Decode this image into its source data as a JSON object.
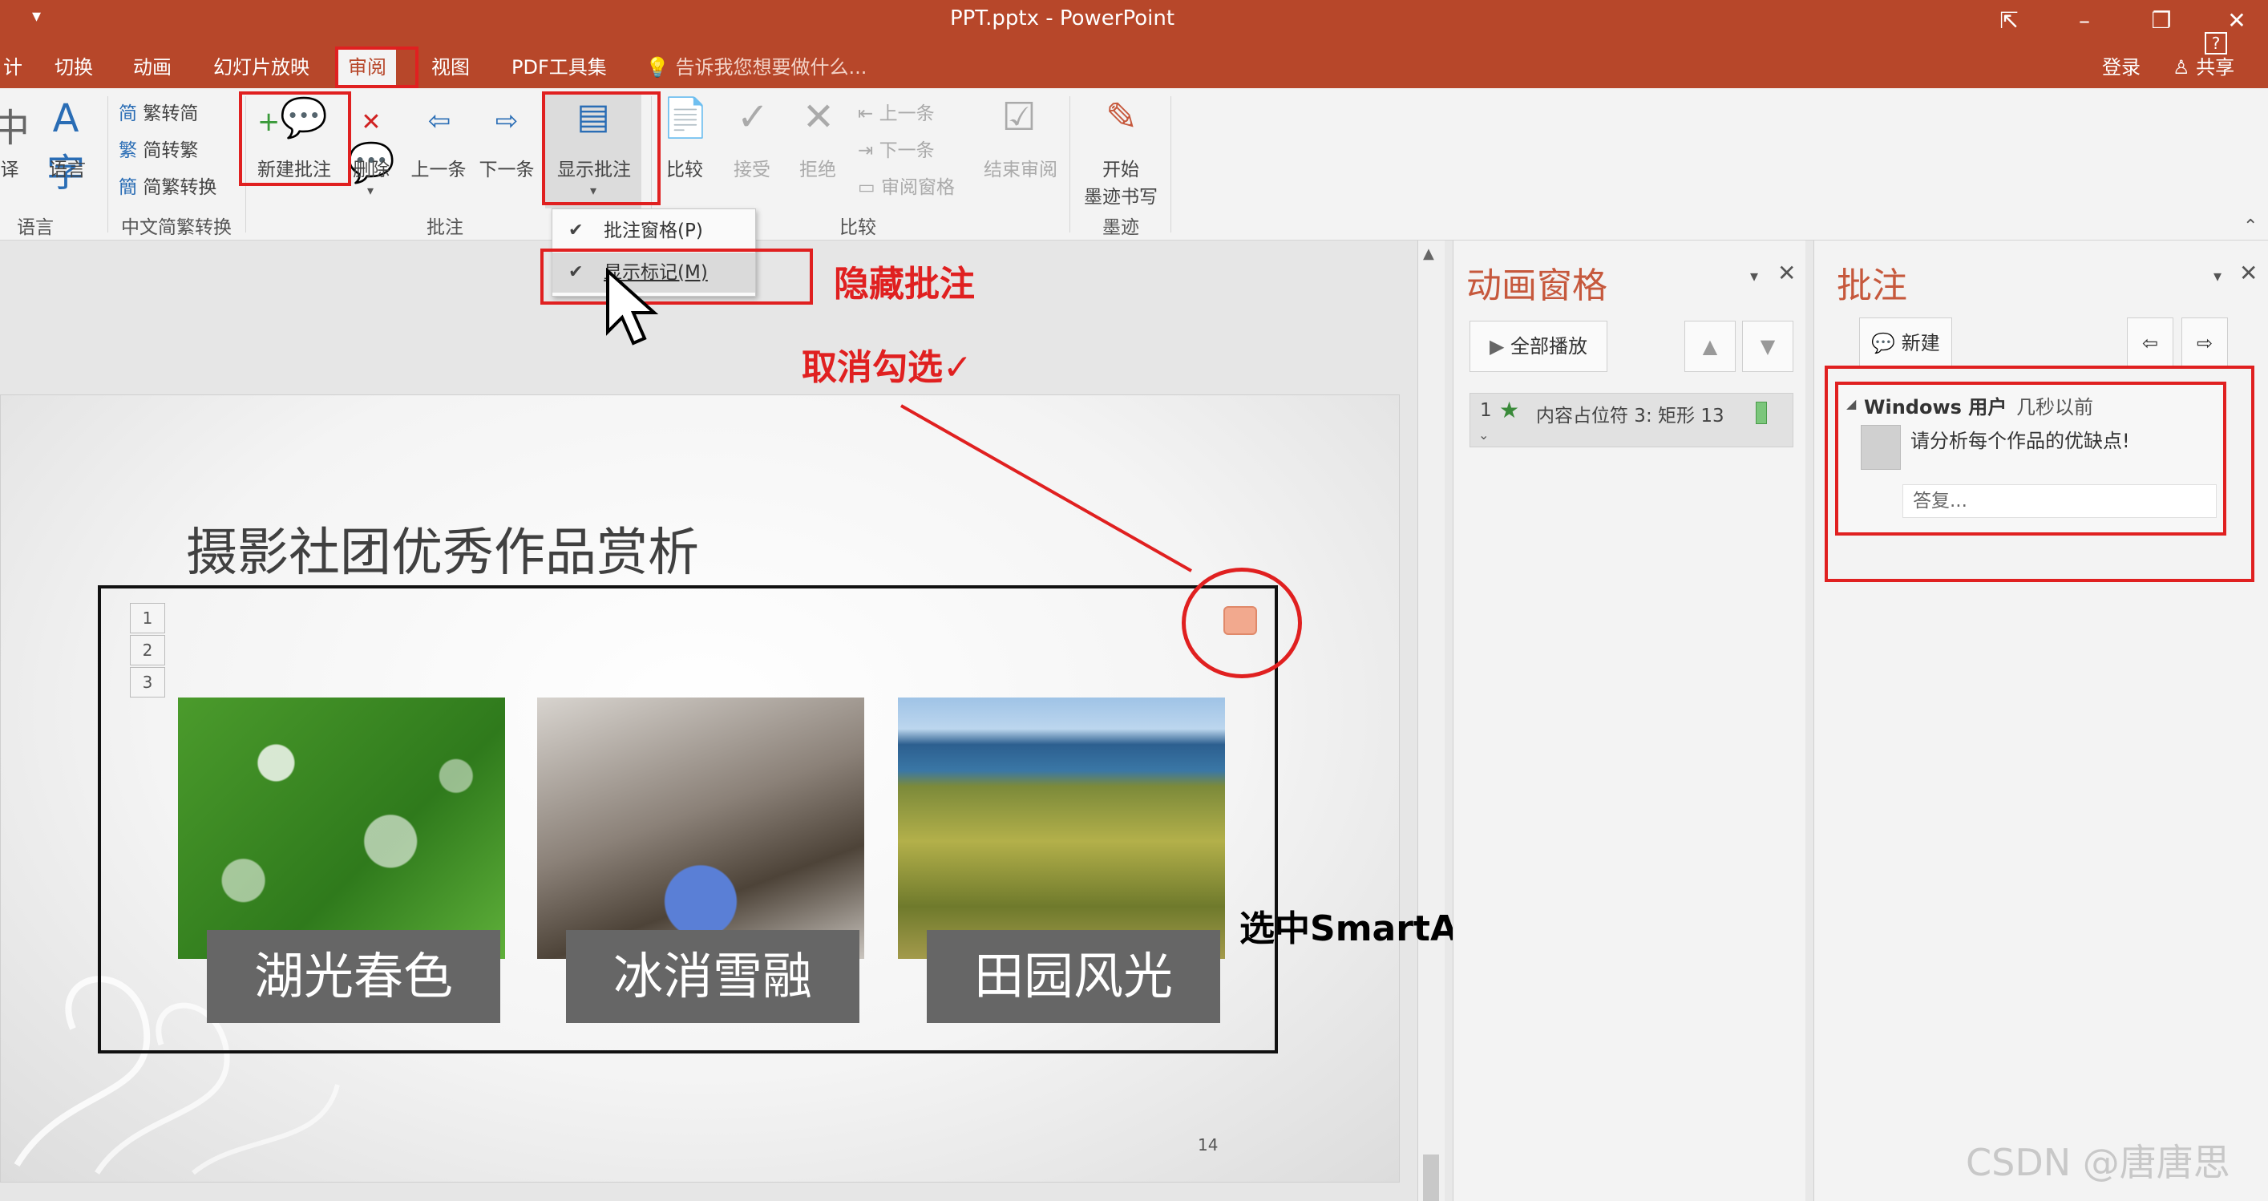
{
  "window": {
    "title": "PPT.pptx - PowerPoint"
  },
  "tabs": [
    "计",
    "切换",
    "动画",
    "幻灯片放映",
    "审阅",
    "视图",
    "PDF工具集"
  ],
  "active_tab": "审阅",
  "tell_me": "告诉我您想要做什么...",
  "account": {
    "login": "登录",
    "share": "共享",
    "help": "?"
  },
  "ribbon": {
    "language_group": {
      "translate": "译",
      "language": "语言",
      "label": "语言"
    },
    "chinese_group": {
      "to_simple": "繁转简",
      "to_trad": "简转繁",
      "convert": "简繁转换",
      "label": "中文简繁转换"
    },
    "comments_group": {
      "new_comment": "新建批注",
      "delete": "删除",
      "previous": "上一条",
      "next": "下一条",
      "show_comments": "显示批注",
      "label": "批注"
    },
    "compare_group": {
      "compare": "比较",
      "accept": "接受",
      "reject": "拒绝",
      "prev": "上一条",
      "next": "下一条",
      "review_pane": "审阅窗格",
      "end_review": "结束审阅",
      "label": "比较"
    },
    "ink_group": {
      "start_line1": "开始",
      "start_line2": "墨迹书写",
      "label": "墨迹"
    }
  },
  "dropdown": {
    "comments_pane": "批注窗格(P)",
    "show_markup": "显示标记(M)"
  },
  "slide": {
    "title": "摄影社团优秀作品赏析",
    "captions": [
      "湖光春色",
      "冰消雪融",
      "田园风光"
    ],
    "side_numbers": [
      "1",
      "2",
      "3"
    ],
    "page_number": "14"
  },
  "animation_pane": {
    "title": "动画窗格",
    "play_all": "全部播放",
    "item": {
      "index": "1",
      "label": "内容占位符 3: 矩形 13"
    }
  },
  "comments_pane": {
    "title": "批注",
    "new": "新建",
    "author": "Windows 用户",
    "time": "几秒以前",
    "text": "请分析每个作品的优缺点!",
    "reply_placeholder": "答复..."
  },
  "annotations": {
    "hide_comments": "隐藏批注",
    "uncheck": "取消勾选✓",
    "select_smartart": "选中SmartArt"
  },
  "watermark": "CSDN @唐唐思",
  "colors": {
    "accent": "#b7472a",
    "annotation_red": "#e02020",
    "pane_title": "#c6583c"
  }
}
